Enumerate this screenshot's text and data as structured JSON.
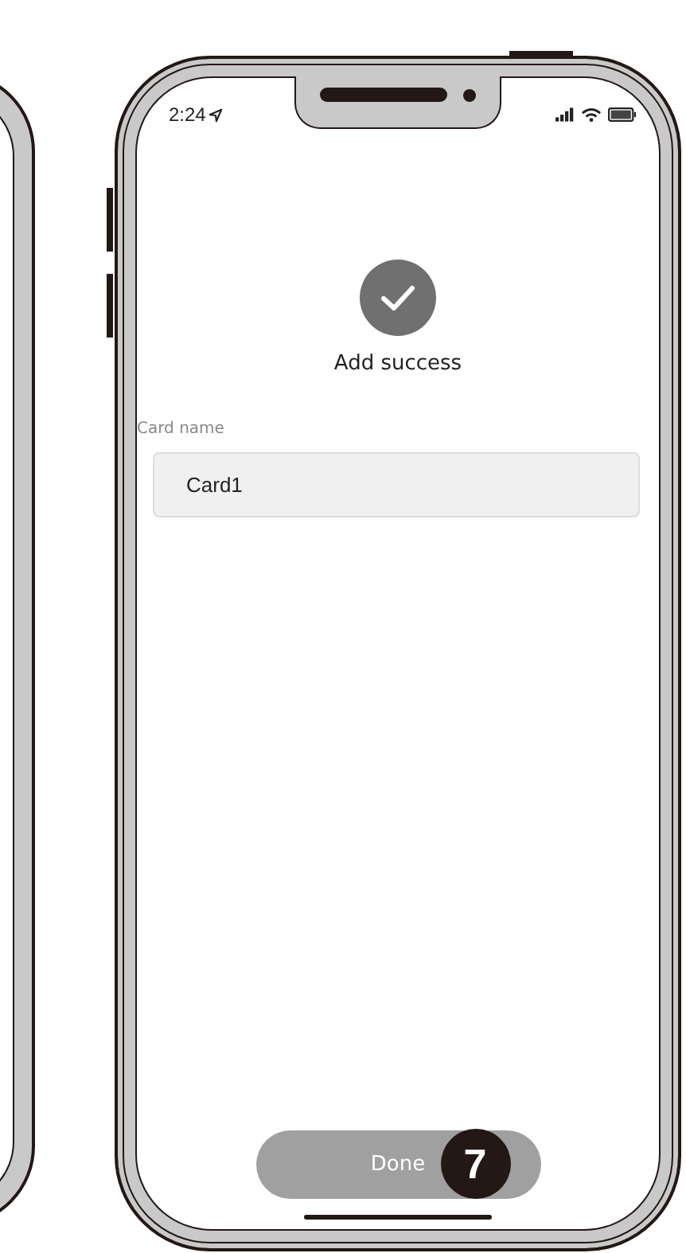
{
  "status_bar": {
    "time": "2:24"
  },
  "result": {
    "title": "Add success"
  },
  "card_name": {
    "label": "Card name",
    "value": "Card1"
  },
  "done_button": {
    "label": "Done",
    "callout": "7"
  }
}
